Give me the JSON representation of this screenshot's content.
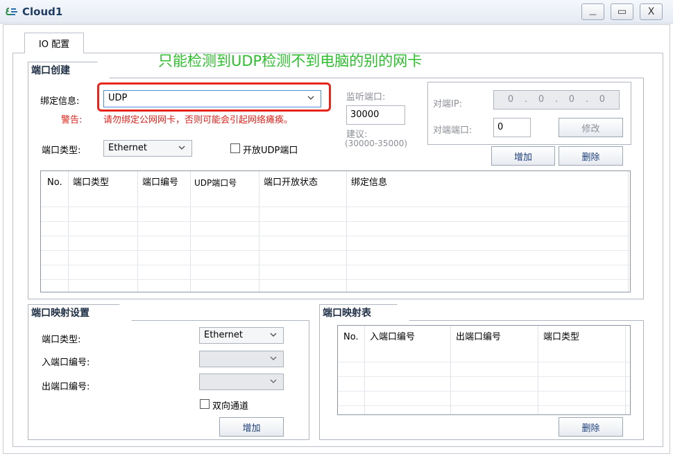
{
  "window": {
    "title": "Cloud1",
    "controls": {
      "minimize": "—",
      "maximize": "▭",
      "close": "X"
    }
  },
  "tab": {
    "label": "IO 配置"
  },
  "annotation": "只能检测到UDP检测不到电脑的别的网卡",
  "port_create": {
    "group_title": "端口创建",
    "bind_label": "绑定信息:",
    "bind_value": "UDP",
    "warning_label": "警告:",
    "warning_text": "请勿绑定公网网卡，否则可能会引起网络瘫痪。",
    "port_type_label": "端口类型:",
    "port_type_value": "Ethernet",
    "open_udp_label": "开放UDP端口",
    "listen_label": "监听端口:",
    "listen_value": "30000",
    "suggest_label": "建议:",
    "suggest_range": "(30000-35000)",
    "peer_ip_label": "对端IP:",
    "peer_ip_octets": [
      "0",
      "0",
      "0",
      "0"
    ],
    "peer_port_label": "对端端口:",
    "peer_port_value": "0",
    "modify_button": "修改",
    "add_button": "增加",
    "delete_button": "删除",
    "table_headers": [
      "No.",
      "端口类型",
      "端口编号",
      "UDP端口号",
      "端口开放状态",
      "绑定信息"
    ]
  },
  "port_mapping": {
    "group_title": "端口映射设置",
    "port_type_label": "端口类型:",
    "port_type_value": "Ethernet",
    "in_port_label": "入端口编号:",
    "out_port_label": "出端口编号:",
    "bidirectional_label": "双向通道",
    "add_button": "增加"
  },
  "mapping_table": {
    "group_title": "端口映射表",
    "headers": [
      "No.",
      "入端口编号",
      "出端口编号",
      "端口类型"
    ],
    "delete_button": "删除"
  },
  "colors": {
    "warning": "#e0221b",
    "annotation": "#2cbf2c",
    "highlight": "#e8251d",
    "combo_focus": "#4a90d9"
  }
}
